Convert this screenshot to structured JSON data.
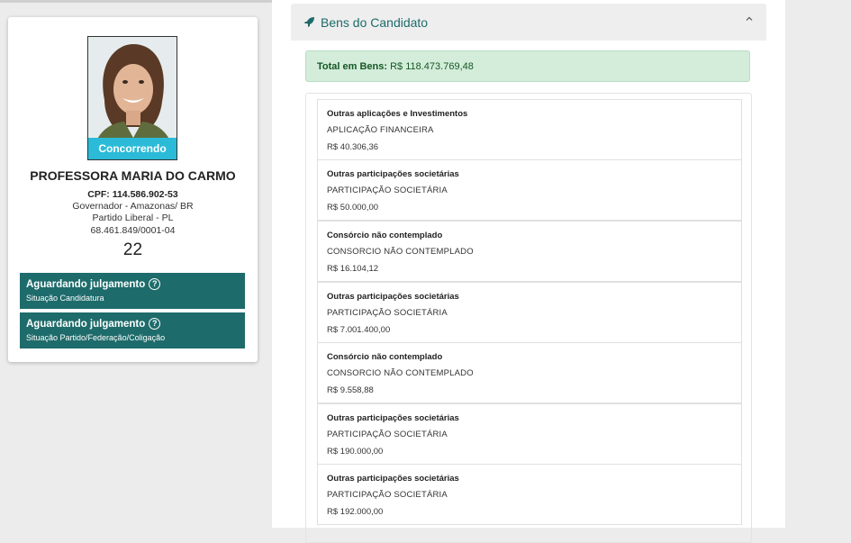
{
  "candidate": {
    "status_badge": "Concorrendo",
    "name": "PROFESSORA MARIA DO CARMO",
    "cpf": "CPF: 114.586.902-53",
    "cargo": "Governador - Amazonas/ BR",
    "partido": "Partido Liberal - PL",
    "cnpj": "68.461.849/0001-04",
    "numero": "22"
  },
  "situacoes": [
    {
      "title": "Aguardando julgamento",
      "subtitle": "Situação Candidatura"
    },
    {
      "title": "Aguardando julgamento",
      "subtitle": "Situação Partido/Federação/Coligação"
    }
  ],
  "bens": {
    "section_title": "Bens do Candidato",
    "total_label": "Total em Bens:",
    "total_value": "R$ 118.473.769,48",
    "items": [
      {
        "tipo": "Outras aplicações e Investimentos",
        "descricao": "APLICAÇÃO FINANCEIRA",
        "valor": "R$ 40.306,36"
      },
      {
        "tipo": "Outras participações societárias",
        "descricao": "PARTICIPAÇÃO SOCIETÁRIA",
        "valor": "R$ 50.000,00"
      },
      {
        "tipo": "Consórcio não contemplado",
        "descricao": "CONSORCIO NÃO CONTEMPLADO",
        "valor": "R$ 16.104,12"
      },
      {
        "tipo": "Outras participações societárias",
        "descricao": "PARTICIPAÇÃO SOCIETÁRIA",
        "valor": "R$ 7.001.400,00"
      },
      {
        "tipo": "Consórcio não contemplado",
        "descricao": "CONSORCIO NÃO CONTEMPLADO",
        "valor": "R$ 9.558,88"
      },
      {
        "tipo": "Outras participações societárias",
        "descricao": "PARTICIPAÇÃO SOCIETÁRIA",
        "valor": "R$ 190.000,00"
      },
      {
        "tipo": "Outras participações societárias",
        "descricao": "PARTICIPAÇÃO SOCIETÁRIA",
        "valor": "R$ 192.000,00"
      }
    ]
  },
  "colors": {
    "accent": "#1e6b6b",
    "badge": "#2bbbd8",
    "total_bg": "#d4edda"
  },
  "icons": {
    "section": "rocket-icon",
    "collapse": "chevron-up-icon",
    "help": "question-circle-icon"
  }
}
